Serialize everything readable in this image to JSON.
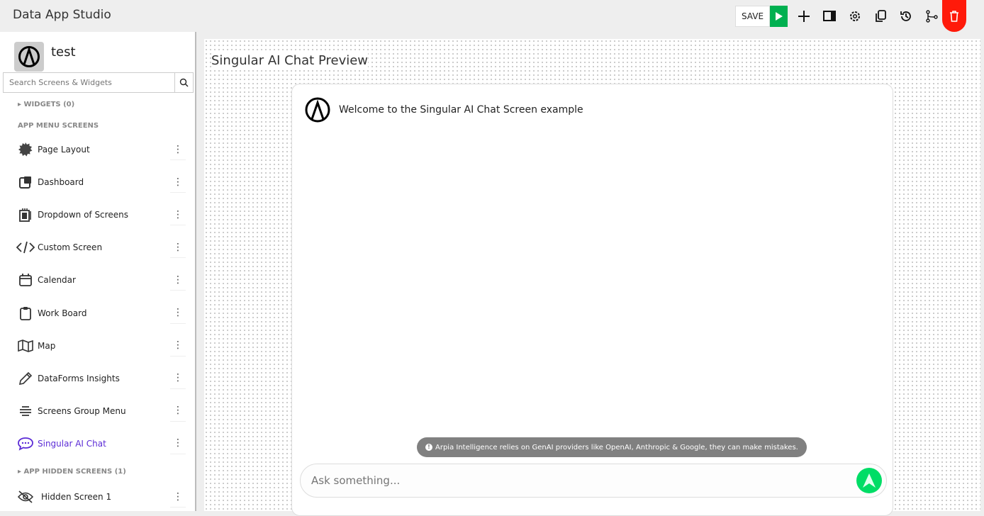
{
  "header": {
    "title": "Data App Studio",
    "save_label": "SAVE",
    "tools": [
      "play-icon",
      "plus-icon",
      "panel-icon",
      "gear-icon",
      "copy-icon",
      "history-icon",
      "branch-icon",
      "trash-icon"
    ]
  },
  "sidebar": {
    "app_name": "test",
    "search_placeholder": "Search Screens & Widgets",
    "widgets_label": "WIDGETS (0)",
    "menu_label": "APP MENU SCREENS",
    "hidden_label": "APP HIDDEN SCREENS (1)",
    "items": [
      {
        "label": "Page Layout",
        "icon": "gear-badge-icon"
      },
      {
        "label": "Dashboard",
        "icon": "dashboard-icon"
      },
      {
        "label": "Dropdown of Screens",
        "icon": "dropdown-icon"
      },
      {
        "label": "Custom Screen",
        "icon": "code-icon"
      },
      {
        "label": "Calendar",
        "icon": "calendar-icon"
      },
      {
        "label": "Work Board",
        "icon": "clipboard-icon"
      },
      {
        "label": "Map",
        "icon": "map-icon"
      },
      {
        "label": "DataForms Insights",
        "icon": "pencil-icon"
      },
      {
        "label": "Screens Group Menu",
        "icon": "menu-icon"
      },
      {
        "label": "Singular AI Chat",
        "icon": "chat-icon",
        "active": true
      }
    ],
    "hidden_items": [
      {
        "label": "Hidden Screen 1",
        "icon": "eye-off-icon"
      }
    ]
  },
  "main": {
    "title": "Singular AI Chat Preview",
    "welcome": "Welcome to the Singular AI Chat Screen example",
    "notice": "Arpia Intelligence relies on GenAI providers like OpenAI, Anthropic & Google, they can make mistakes.",
    "input_placeholder": "Ask something..."
  },
  "colors": {
    "accent": "#5b2bd6",
    "play": "#00b050",
    "delete": "#ff1a0a",
    "send": "#00dd66"
  }
}
